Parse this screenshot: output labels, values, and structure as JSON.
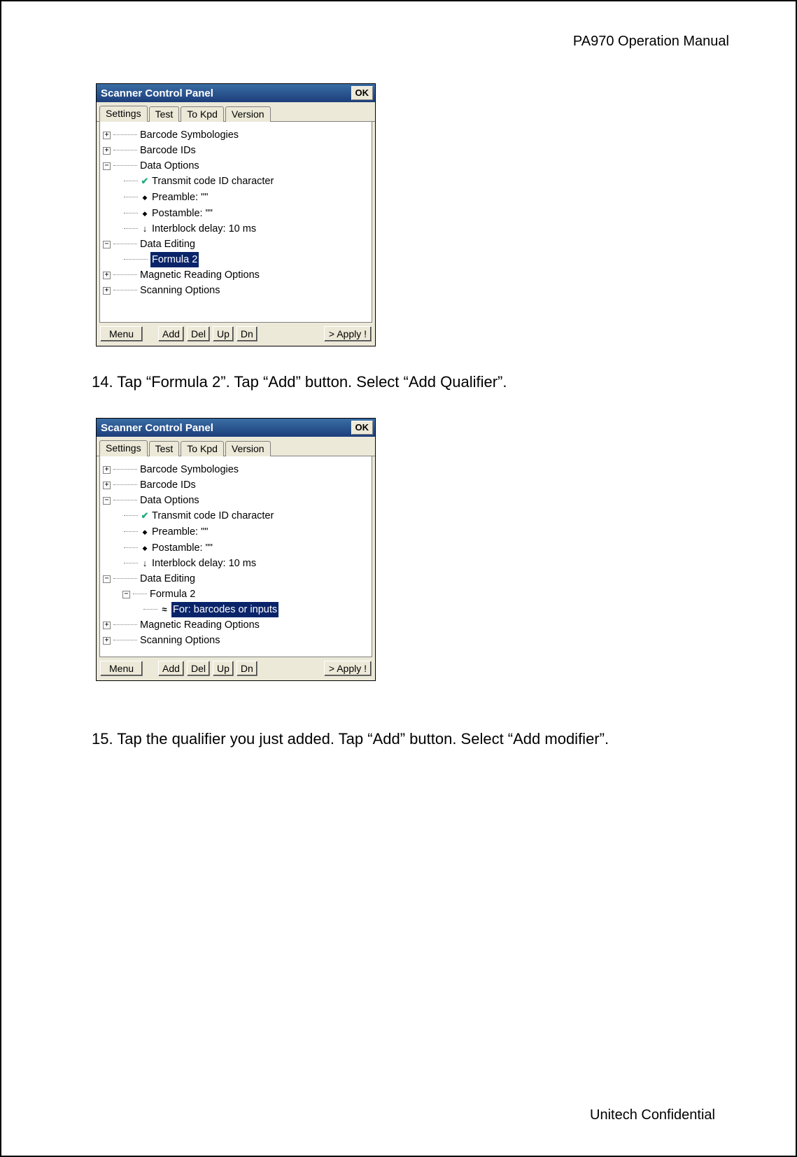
{
  "header": "PA970 Operation Manual",
  "footer": "Unitech Confidential",
  "step14": "14. Tap “Formula 2”. Tap “Add” button. Select “Add Qualifier”.",
  "step15": "15. Tap the qualifier you just added. Tap “Add” button. Select “Add modifier”.",
  "win": {
    "title": "Scanner Control Panel",
    "ok": "OK",
    "tabs": {
      "settings": "Settings",
      "test": "Test",
      "tokpd": "To Kpd",
      "version": "Version"
    },
    "toolbar": {
      "menu": "Menu",
      "add": "Add",
      "del": "Del",
      "up": "Up",
      "dn": "Dn",
      "apply": "> Apply !"
    }
  },
  "tree1": {
    "n0": "Barcode Symbologies",
    "n1": "Barcode IDs",
    "n2": "Data Options",
    "n2a": "Transmit code ID character",
    "n2b": "Preamble: \"\"",
    "n2c": "Postamble: \"\"",
    "n2d": "Interblock delay: 10 ms",
    "n3": "Data Editing",
    "n3a": "Formula 2",
    "n4": "Magnetic Reading Options",
    "n5": "Scanning Options"
  },
  "tree2": {
    "n0": "Barcode Symbologies",
    "n1": "Barcode IDs",
    "n2": "Data Options",
    "n2a": "Transmit code ID character",
    "n2b": "Preamble: \"\"",
    "n2c": "Postamble: \"\"",
    "n2d": "Interblock delay: 10 ms",
    "n3": "Data Editing",
    "n3a": "Formula 2",
    "n3a1": "For: barcodes or inputs",
    "n4": "Magnetic Reading Options",
    "n5": "Scanning Options"
  }
}
